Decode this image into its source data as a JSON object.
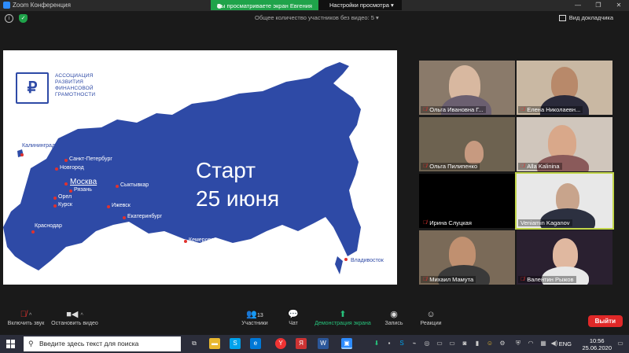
{
  "window": {
    "title": "Zoom Конференция",
    "banner_viewing": "Вы просматриваете экран Евгения",
    "banner_settings": "Настройки просмотра"
  },
  "topbar": {
    "participant_count": "Общее количество участников без видео: 5",
    "view_label": "Вид докладчика"
  },
  "slide": {
    "org_lines": [
      "АССОЦИАЦИЯ",
      "РАЗВИТИЯ",
      "ФИНАНСОВОЙ",
      "ГРАМОТНОСТИ"
    ],
    "start_line1": "Старт",
    "start_line2": "25 июня",
    "cities": [
      "Калининград",
      "Санкт-Петербург",
      "Новгород",
      "Москва",
      "Рязань",
      "Орел",
      "Курск",
      "Сыктывкар",
      "Ижевск",
      "Екатеринбург",
      "Краснодар",
      "Кемерово",
      "Владивосток"
    ],
    "colors": {
      "brand_blue": "#2e4aa6",
      "marker_red": "#e0322e"
    }
  },
  "participants": [
    {
      "name": "Ольга Ивановна Г..."
    },
    {
      "name": "Елена Николаевн..."
    },
    {
      "name": "Ольга Пилипенко"
    },
    {
      "name": "Alla Kalinina"
    },
    {
      "name": "Ирина Слуцкая"
    },
    {
      "name": "Veniamin Kaganov"
    },
    {
      "name": "Михаил Мамута"
    },
    {
      "name": "Валентин Рыжов"
    }
  ],
  "toolbar": {
    "unmute": "Включить звук",
    "start_video": "Остановить видео",
    "participants": "Участники",
    "participants_count": "13",
    "chat": "Чат",
    "share": "Демонстрация экрана",
    "record": "Запись",
    "reactions": "Реакции",
    "leave": "Выйти"
  },
  "taskbar": {
    "search_placeholder": "Введите здесь текст для поиска",
    "lang": "ENG",
    "time": "10:56",
    "date": "25.06.2020"
  }
}
